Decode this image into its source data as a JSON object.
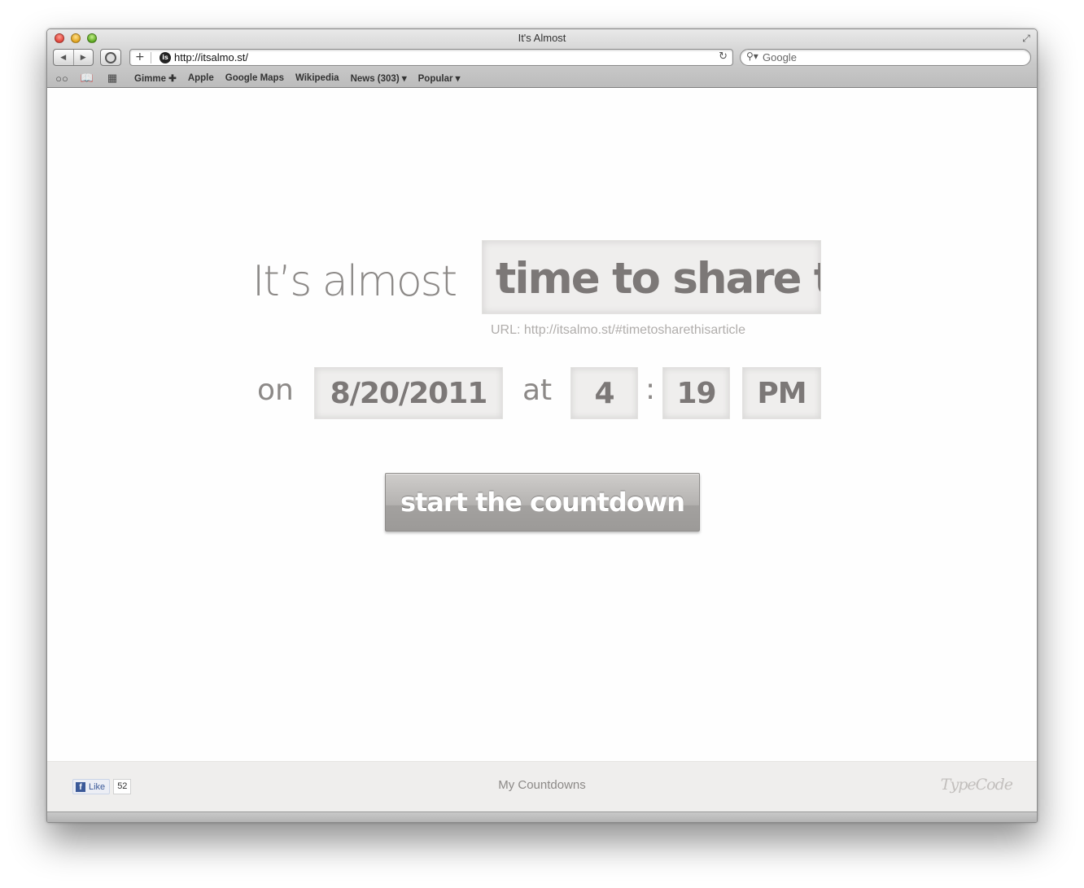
{
  "window": {
    "title": "It's Almost"
  },
  "toolbar": {
    "back_icon": "back-arrow-icon",
    "forward_icon": "forward-arrow-icon",
    "reader_icon": "reader-icon",
    "add_bookmark_label": "+",
    "url": "http://itsalmo.st/",
    "favicon_label": "is",
    "reload_icon": "reload-icon",
    "search_placeholder": "Google"
  },
  "bookmarks_bar": {
    "icons": [
      "reading-list-icon",
      "bookmarks-book-icon",
      "top-sites-grid-icon"
    ],
    "items": [
      {
        "label": "Gimme ✚"
      },
      {
        "label": "Apple"
      },
      {
        "label": "Google Maps"
      },
      {
        "label": "Wikipedia"
      },
      {
        "label": "News (303) ▾"
      },
      {
        "label": "Popular ▾"
      }
    ]
  },
  "page": {
    "headline_prefix": "It’s almost",
    "event_value": "time to share tl",
    "url_hint": "URL: http://itsalmo.st/#timetosharethisarticle",
    "on_label": "on",
    "date_value": "8/20/2011",
    "at_label": "at",
    "hour_value": "4",
    "time_separator": ":",
    "minute_value": "19",
    "ampm_value": "PM",
    "cta_label": "start the countdown"
  },
  "footer": {
    "like_label": "Like",
    "like_count": "52",
    "my_countdowns_label": "My Countdowns",
    "logo_text": "TypeCode"
  },
  "colors": {
    "text_gray": "#8c8987",
    "input_bg": "#efeeed",
    "button_gray": "#a3a19f",
    "facebook_blue": "#3b5998"
  }
}
